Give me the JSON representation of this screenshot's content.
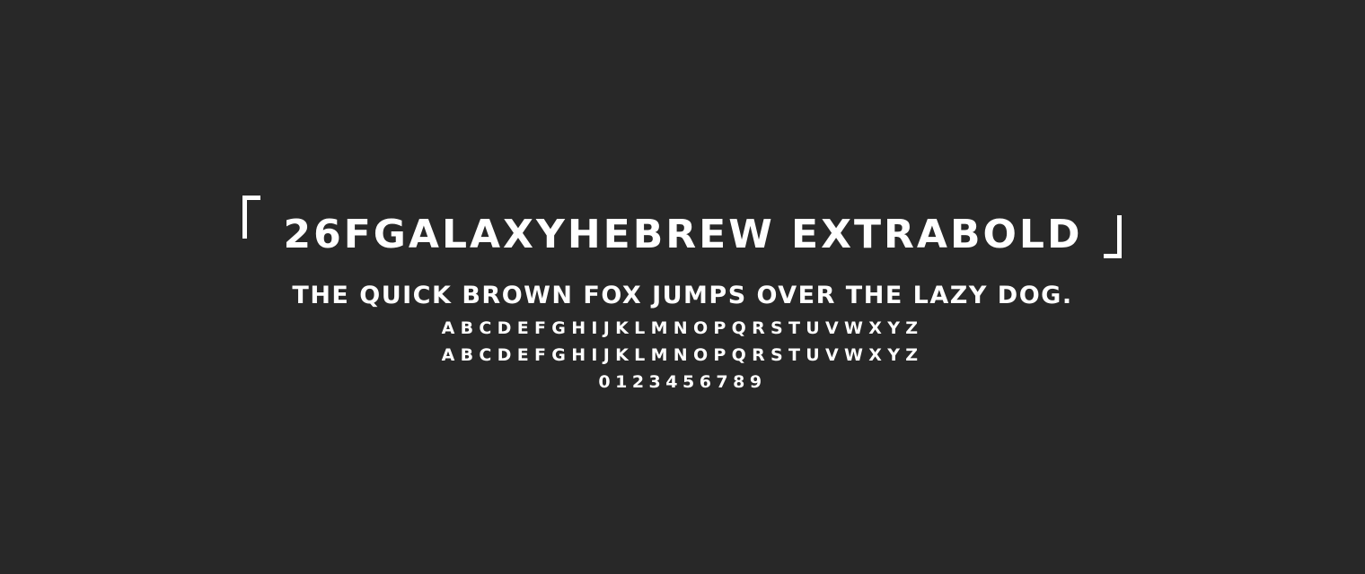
{
  "specimen": {
    "title": "26FGALAXYHEBREW EXTRABOLD",
    "pangram": "THE QUICK BROWN FOX JUMPS OVER THE LAZY DOG.",
    "uppercase": "ABCDEFGHIJKLMNOPQRSTUVWXYZ",
    "lowercase": "ABCDEFGHIJKLMNOPQRSTUVWXYZ",
    "digits": "0123456789"
  },
  "colors": {
    "background": "#282828",
    "text": "#ffffff"
  }
}
